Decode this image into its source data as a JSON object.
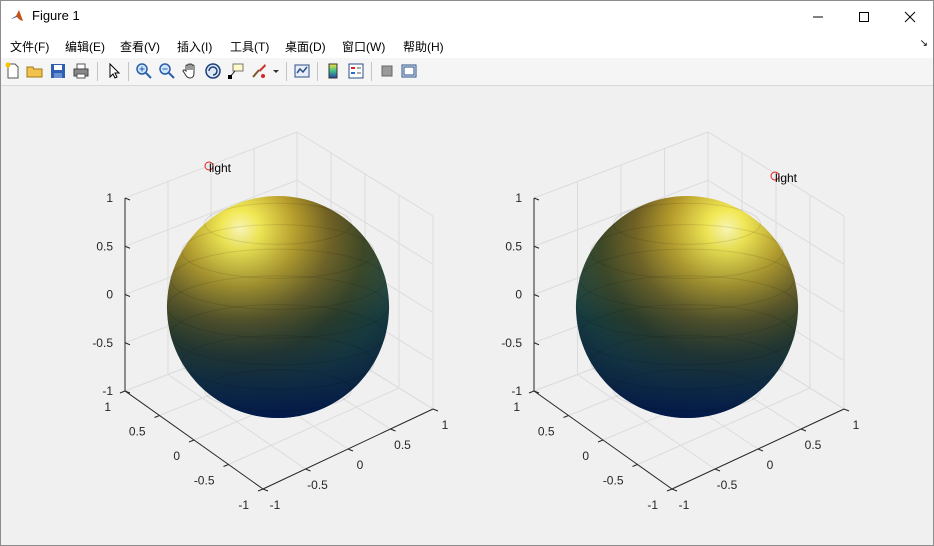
{
  "window": {
    "title": "Figure 1"
  },
  "menu": [
    "文件(F)",
    "编辑(E)",
    "查看(V)",
    "插入(I)",
    "工具(T)",
    "桌面(D)",
    "窗口(W)",
    "帮助(H)"
  ],
  "toolbar": [
    "new-figure-icon",
    "open-file-icon",
    "save-icon",
    "print-icon",
    "edit-plot-arrow-icon",
    "zoom-in-icon",
    "zoom-out-icon",
    "pan-hand-icon",
    "rotate-3d-icon",
    "data-cursor-icon",
    "brush-icon",
    "brush-dropdown-icon",
    "link-plot-icon",
    "colorbar-icon",
    "legend-icon",
    "hide-plot-tools-icon",
    "show-plot-tools-icon"
  ],
  "axes": [
    {
      "light_label": "light",
      "z_ticks": [
        "1",
        "0.5",
        "0",
        "-0.5",
        "-1"
      ],
      "y_ticks": [
        "1",
        "0.5",
        "0",
        "-0.5",
        "-1"
      ],
      "x_ticks": [
        "-1",
        "-0.5",
        "0",
        "0.5",
        "1"
      ],
      "highlight": "upper-left"
    },
    {
      "light_label": "light",
      "z_ticks": [
        "1",
        "0.5",
        "0",
        "-0.5",
        "-1"
      ],
      "y_ticks": [
        "1",
        "0.5",
        "0",
        "-0.5",
        "-1"
      ],
      "x_ticks": [
        "-1",
        "-0.5",
        "0",
        "0.5",
        "1"
      ],
      "highlight": "upper-right"
    }
  ],
  "colors": {
    "light_marker": "#e02020",
    "sphere_top": "#f5f06a",
    "sphere_bottom": "#0a1f4a"
  }
}
